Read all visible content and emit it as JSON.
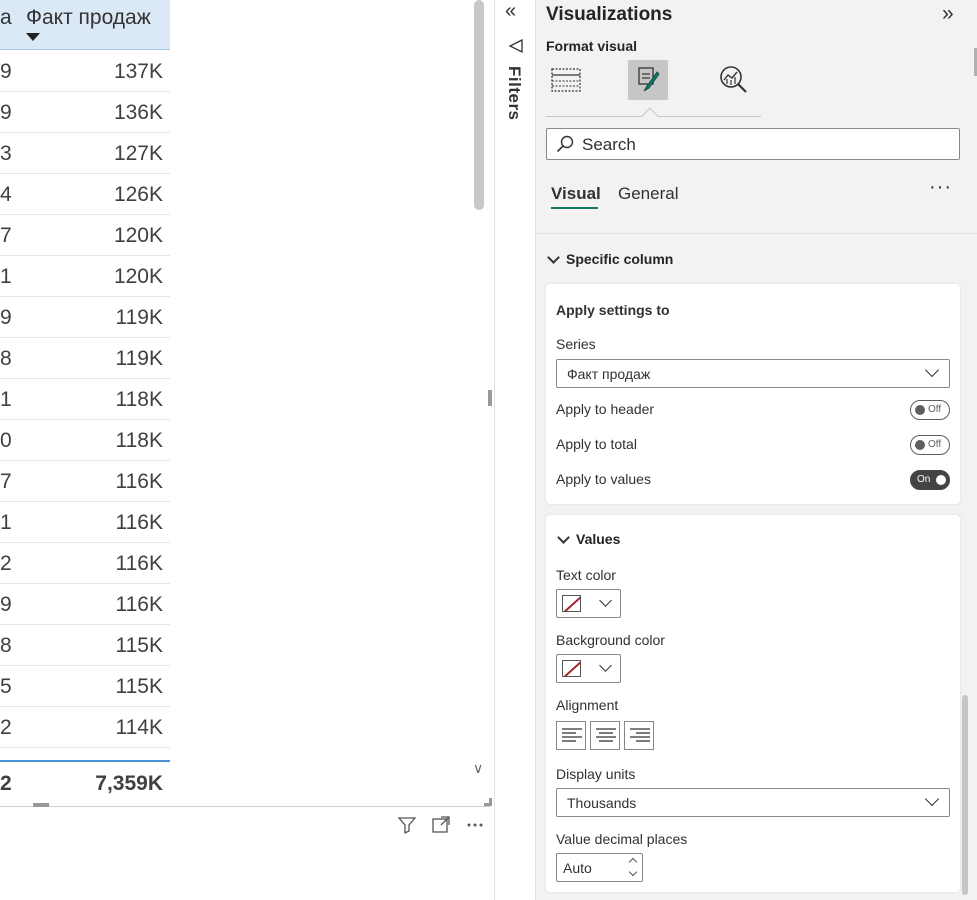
{
  "table": {
    "headers": {
      "col1": "а",
      "col2": "Факт продаж"
    },
    "rows": [
      {
        "c1": "9",
        "c2": "137K"
      },
      {
        "c1": "9",
        "c2": "136K"
      },
      {
        "c1": "3",
        "c2": "127K"
      },
      {
        "c1": "4",
        "c2": "126K"
      },
      {
        "c1": "7",
        "c2": "120K"
      },
      {
        "c1": "1",
        "c2": "120K"
      },
      {
        "c1": "9",
        "c2": "119K"
      },
      {
        "c1": "8",
        "c2": "119K"
      },
      {
        "c1": "1",
        "c2": "118K"
      },
      {
        "c1": "0",
        "c2": "118K"
      },
      {
        "c1": "7",
        "c2": "116K"
      },
      {
        "c1": "1",
        "c2": "116K"
      },
      {
        "c1": "2",
        "c2": "116K"
      },
      {
        "c1": "9",
        "c2": "116K"
      },
      {
        "c1": "8",
        "c2": "115K"
      },
      {
        "c1": "5",
        "c2": "115K"
      },
      {
        "c1": "2",
        "c2": "114K"
      }
    ],
    "total": {
      "c1": "2",
      "c2": "7,359K"
    }
  },
  "filters": {
    "label": "Filters"
  },
  "viz": {
    "title": "Visualizations",
    "format_visual_label": "Format visual",
    "search_placeholder": "Search",
    "tabs": {
      "visual": "Visual",
      "general": "General",
      "more": "···"
    },
    "specific_column": {
      "title": "Specific column",
      "apply_settings_to": "Apply settings to",
      "series_label": "Series",
      "series_value": "Факт продаж",
      "apply_header": {
        "label": "Apply to header",
        "state": "Off"
      },
      "apply_total": {
        "label": "Apply to total",
        "state": "Off"
      },
      "apply_values": {
        "label": "Apply to values",
        "state": "On"
      }
    },
    "values": {
      "title": "Values",
      "text_color_label": "Text color",
      "bg_color_label": "Background color",
      "alignment_label": "Alignment",
      "display_units_label": "Display units",
      "display_units_value": "Thousands",
      "decimal_label": "Value decimal places",
      "decimal_value": "Auto"
    }
  }
}
